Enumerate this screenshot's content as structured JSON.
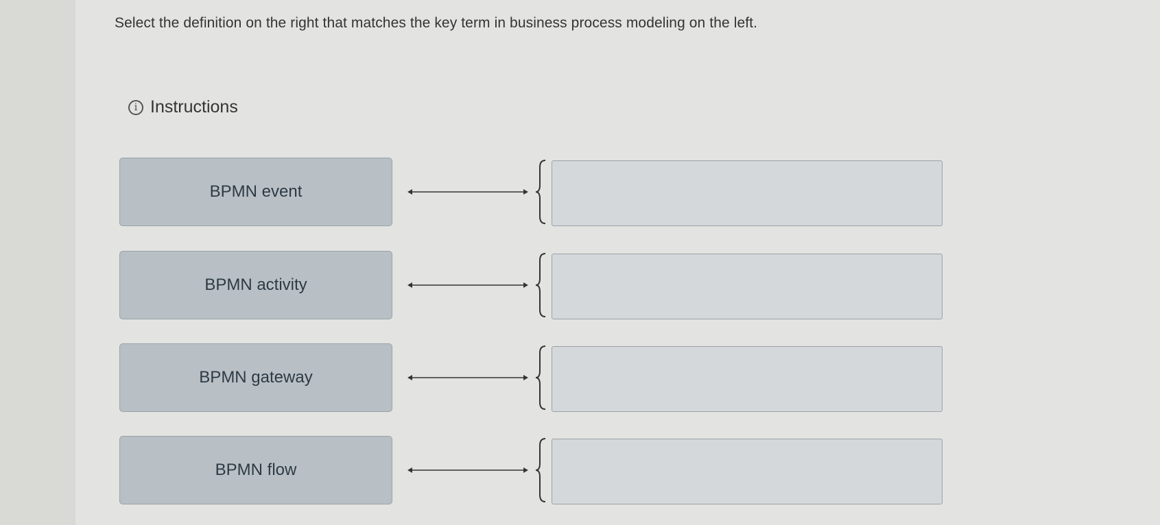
{
  "question": {
    "prompt": "Select the definition on the right that matches the key term in business process modeling on the left."
  },
  "instructions": {
    "label": "Instructions",
    "icon": "info-icon"
  },
  "matching": {
    "terms": [
      {
        "label": "BPMN event"
      },
      {
        "label": "BPMN activity"
      },
      {
        "label": "BPMN gateway"
      },
      {
        "label": "BPMN flow"
      }
    ]
  }
}
